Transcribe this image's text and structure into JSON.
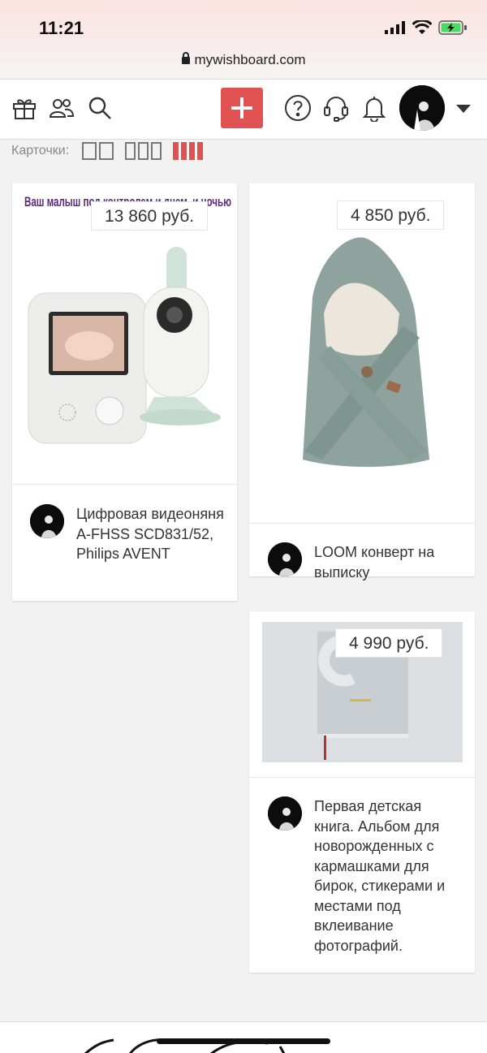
{
  "status": {
    "time": "11:21",
    "url": "mywishboard.com"
  },
  "nav": {
    "icons": [
      "gift-icon",
      "friends-icon",
      "search-icon",
      "help-icon",
      "support-headset-icon",
      "bell-icon"
    ],
    "add_icon": "plus-icon"
  },
  "cards_bar": {
    "label": "Карточки:",
    "layout_options": [
      "two-column",
      "three-column",
      "four-column"
    ],
    "active_layout": "four-column",
    "active_color": "#e05252"
  },
  "items": [
    {
      "price": "13 860 руб.",
      "title": "Цифровая видеоняня A-FHSS SCD831/52, Philips AVENT",
      "banner_text": "Ваш малыш под контролем и днем, и ночью"
    },
    {
      "price": "4 850 руб.",
      "title": "LOOM конверт на выписку"
    },
    {
      "price": "4 990 руб.",
      "title": "Первая детская книга. Альбом для новорожденных с кармашками для бирок, стикерами и местами под вклеивание фотографий."
    }
  ]
}
